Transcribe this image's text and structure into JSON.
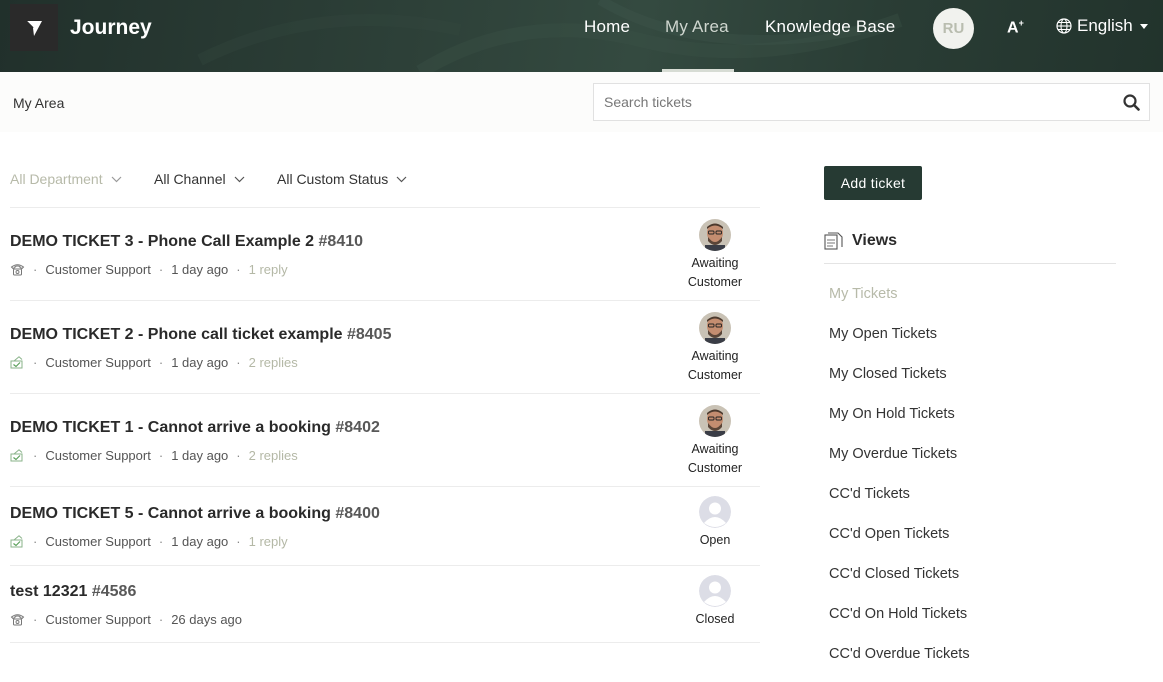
{
  "header": {
    "brand": "Journey",
    "nav": {
      "home": "Home",
      "my_area": "My Area",
      "knowledge_base": "Knowledge Base"
    },
    "user_initials": "RU",
    "accessibility_label": "A",
    "language": "English",
    "colors": {
      "header_bg": "#2d4038",
      "active_nav": "#cfd6cf"
    }
  },
  "subbar": {
    "breadcrumb": "My Area",
    "search_placeholder": "Search tickets",
    "search_value": ""
  },
  "filters": {
    "department": "All Department",
    "channel": "All Channel",
    "custom_status": "All Custom Status"
  },
  "tickets": [
    {
      "title": "DEMO TICKET 3 - Phone Call Example 2",
      "number": "#8410",
      "channel_icon": "phone-icon",
      "department": "Customer Support",
      "time": "1 day ago",
      "replies": "1 reply",
      "status_line1": "Awaiting",
      "status_line2": "Customer",
      "avatar": "agent-photo"
    },
    {
      "title": "DEMO TICKET 2 - Phone call ticket example",
      "number": "#8405",
      "channel_icon": "web-form-icon",
      "department": "Customer Support",
      "time": "1 day ago",
      "replies": "2 replies",
      "status_line1": "Awaiting",
      "status_line2": "Customer",
      "avatar": "agent-photo"
    },
    {
      "title": "DEMO TICKET 1 - Cannot arrive a booking",
      "number": "#8402",
      "channel_icon": "web-form-icon",
      "department": "Customer Support",
      "time": "1 day ago",
      "replies": "2 replies",
      "status_line1": "Awaiting",
      "status_line2": "Customer",
      "avatar": "agent-photo"
    },
    {
      "title": "DEMO TICKET 5 - Cannot arrive a booking",
      "number": "#8400",
      "channel_icon": "web-form-icon",
      "department": "Customer Support",
      "time": "1 day ago",
      "replies": "1 reply",
      "status_line1": "Open",
      "status_line2": "",
      "avatar": "default-avatar"
    },
    {
      "title": "test 12321",
      "number": "#4586",
      "channel_icon": "phone-icon",
      "department": "Customer Support",
      "time": "26 days ago",
      "replies": "",
      "status_line1": "Closed",
      "status_line2": "",
      "avatar": "default-avatar"
    }
  ],
  "sidebar": {
    "add_ticket": "Add ticket",
    "views_title": "Views",
    "views": [
      "My Tickets",
      "My Open Tickets",
      "My Closed Tickets",
      "My On Hold Tickets",
      "My Overdue Tickets",
      "CC'd Tickets",
      "CC'd Open Tickets",
      "CC'd Closed Tickets",
      "CC'd On Hold Tickets",
      "CC'd Overdue Tickets"
    ],
    "active_view": 0,
    "colors": {
      "button_bg": "#263a33",
      "muted": "#b7baa9"
    }
  }
}
